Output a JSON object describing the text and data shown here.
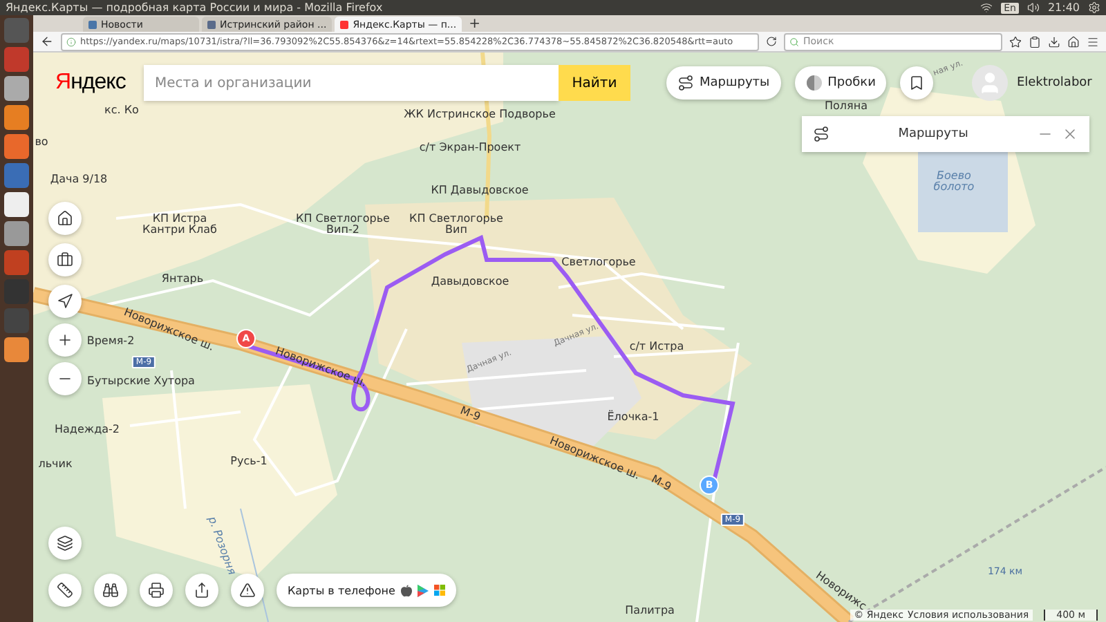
{
  "system_bar": {
    "title": "Яндекс.Карты — подробная карта России и мира - Mozilla Firefox",
    "keyboard": "En",
    "time": "21:40"
  },
  "browser": {
    "tabs": [
      {
        "label": "Новости",
        "selected": false
      },
      {
        "label": "Истринский район ...",
        "selected": false
      },
      {
        "label": "Яндекс.Карты — п...",
        "selected": true
      }
    ],
    "new_tab": "+",
    "url": "https://yandex.ru/maps/10731/istra/?ll=36.793092%2C55.854376&z=14&rtext=55.854228%2C36.774378~55.845872%2C36.820548&rtt=auto",
    "search_placeholder": "Поиск"
  },
  "header": {
    "logo": "Яндекс",
    "search_placeholder": "Места и организации",
    "search_button": "Найти",
    "routes_button": "Маршруты",
    "traffic_button": "Пробки",
    "user": "Elektrolabor"
  },
  "routes_panel": {
    "title": "Маршруты"
  },
  "map": {
    "labels": [
      {
        "text": "кс. Ко",
        "kind": "place"
      },
      {
        "text": "во",
        "kind": "place"
      },
      {
        "text": "ЖК Истринское Подворье",
        "kind": "place"
      },
      {
        "text": "с/т Экран-Проект",
        "kind": "place"
      },
      {
        "text": "Дача 9/18",
        "kind": "place"
      },
      {
        "text": "КП Давыдовское",
        "kind": "place"
      },
      {
        "text": "КП Истра Кантри Клаб",
        "kind": "place"
      },
      {
        "text": "КП Светлогорье Вип-2",
        "kind": "place"
      },
      {
        "text": "КП Светлогорье Вип",
        "kind": "place"
      },
      {
        "text": "Поляна",
        "kind": "place"
      },
      {
        "text": "Янтарь",
        "kind": "place"
      },
      {
        "text": "Давыдовское",
        "kind": "place"
      },
      {
        "text": "Светлогорье",
        "kind": "place"
      },
      {
        "text": "Время-2",
        "kind": "place"
      },
      {
        "text": "Новорижское ш.",
        "kind": "road"
      },
      {
        "text": "Новорижское ш.",
        "kind": "road"
      },
      {
        "text": "Дачная ул.",
        "kind": "street"
      },
      {
        "text": "Дачная ул.",
        "kind": "street"
      },
      {
        "text": "ная ул.",
        "kind": "street"
      },
      {
        "text": "с/т Истра",
        "kind": "place"
      },
      {
        "text": "Бутырские Хутора",
        "kind": "place"
      },
      {
        "text": "М-9",
        "kind": "road"
      },
      {
        "text": "Ёлочка-1",
        "kind": "place"
      },
      {
        "text": "Надежда-2",
        "kind": "place"
      },
      {
        "text": "Новорижское ш.",
        "kind": "road"
      },
      {
        "text": "Русь-1",
        "kind": "place"
      },
      {
        "text": "льчик",
        "kind": "place"
      },
      {
        "text": "М-9",
        "kind": "road"
      },
      {
        "text": "Боево болото",
        "kind": "water"
      },
      {
        "text": "р. Розорня",
        "kind": "water"
      },
      {
        "text": "174 км",
        "kind": "station"
      },
      {
        "text": "Палитра",
        "kind": "place"
      },
      {
        "text": "Новорижс",
        "kind": "road"
      }
    ],
    "shields": [
      "М-9",
      "М-9"
    ],
    "markers": [
      {
        "letter": "A",
        "kind": "start"
      },
      {
        "letter": "B",
        "kind": "end"
      }
    ]
  },
  "promo": {
    "text": "Карты в телефоне"
  },
  "footer": {
    "copyright": "© Яндекс",
    "terms": "Условия использования",
    "scale": "400 м"
  }
}
